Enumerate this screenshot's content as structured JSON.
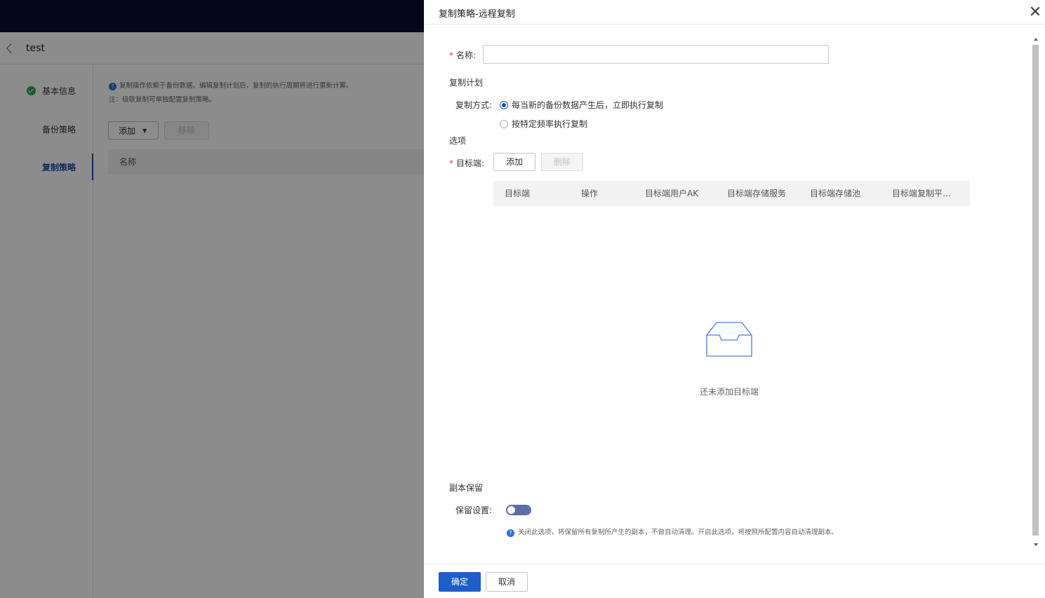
{
  "background": {
    "page_title": "test",
    "nav_items": [
      {
        "label": "基本信息"
      },
      {
        "label": "备份策略"
      },
      {
        "label": "复制策略"
      }
    ],
    "hint_line1": "复制操作依赖于备份数据。编辑复制计划后，复制的执行周期将进行重新计算。",
    "hint_line2": "注：级联复制可单独配置复制策略。",
    "add_label": "添加",
    "remove_label": "移除",
    "table_header_name": "名称"
  },
  "drawer": {
    "title": "复制策略-远程复制",
    "name_label": "名称:",
    "name_value": "",
    "plan_section": "复制计划",
    "mode_label": "复制方式:",
    "mode_options": [
      {
        "label": "每当新的备份数据产生后，立即执行复制",
        "checked": true
      },
      {
        "label": "按特定频率执行复制",
        "checked": false
      }
    ],
    "options_section": "选项",
    "target_label": "目标端:",
    "target_add": "添加",
    "target_delete": "删除",
    "table_columns": [
      "目标端",
      "操作",
      "目标端用户AK",
      "目标端存储服务",
      "目标端存储池",
      "目标端复制平…"
    ],
    "empty_text": "还未添加目标端",
    "retain_section": "副本保留",
    "retain_label": "保留设置:",
    "retain_enabled": false,
    "retain_hint": "关闭此选项，将保留所有复制所产生的副本，不做自动清理。开启此选项，将按照所配置内容自动清理副本。",
    "ok_label": "确定",
    "cancel_label": "取消"
  },
  "colors": {
    "topbar": "#0a0a33",
    "primary": "#1d5ec9",
    "required": "#e23c3c",
    "nav_active": "#1d4ea8",
    "success": "#2aa55a"
  }
}
